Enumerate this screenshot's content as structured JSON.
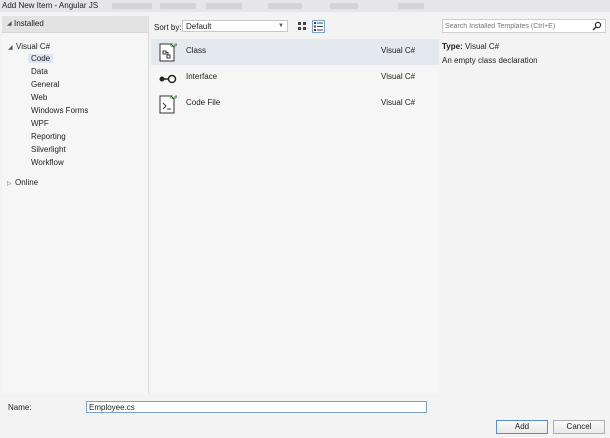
{
  "window": {
    "title": "Add New Item - Angular JS"
  },
  "tree": {
    "header": "Installed",
    "root": "Visual C#",
    "children": [
      "Code",
      "Data",
      "General",
      "Web",
      "Windows Forms",
      "WPF",
      "Reporting",
      "Silverlight",
      "Workflow"
    ],
    "selected": "Code",
    "online": "Online"
  },
  "sort": {
    "label": "Sort by:",
    "value": "Default"
  },
  "templates": [
    {
      "name": "Class",
      "language": "Visual C#",
      "icon": "class-icon"
    },
    {
      "name": "Interface",
      "language": "Visual C#",
      "icon": "interface-icon"
    },
    {
      "name": "Code File",
      "language": "Visual C#",
      "icon": "code-file-icon"
    }
  ],
  "search": {
    "placeholder": "Search Installed Templates (Ctrl+E)"
  },
  "details": {
    "type_label": "Type:",
    "type_value": "Visual C#",
    "description": "An empty class declaration"
  },
  "name_field": {
    "label": "Name:",
    "value": "Employee.cs"
  },
  "buttons": {
    "add": "Add",
    "cancel": "Cancel"
  },
  "colors": {
    "selection": "#e4e8ef",
    "tree_selection": "#dde6f2",
    "focus_border": "#7aa0cc"
  }
}
